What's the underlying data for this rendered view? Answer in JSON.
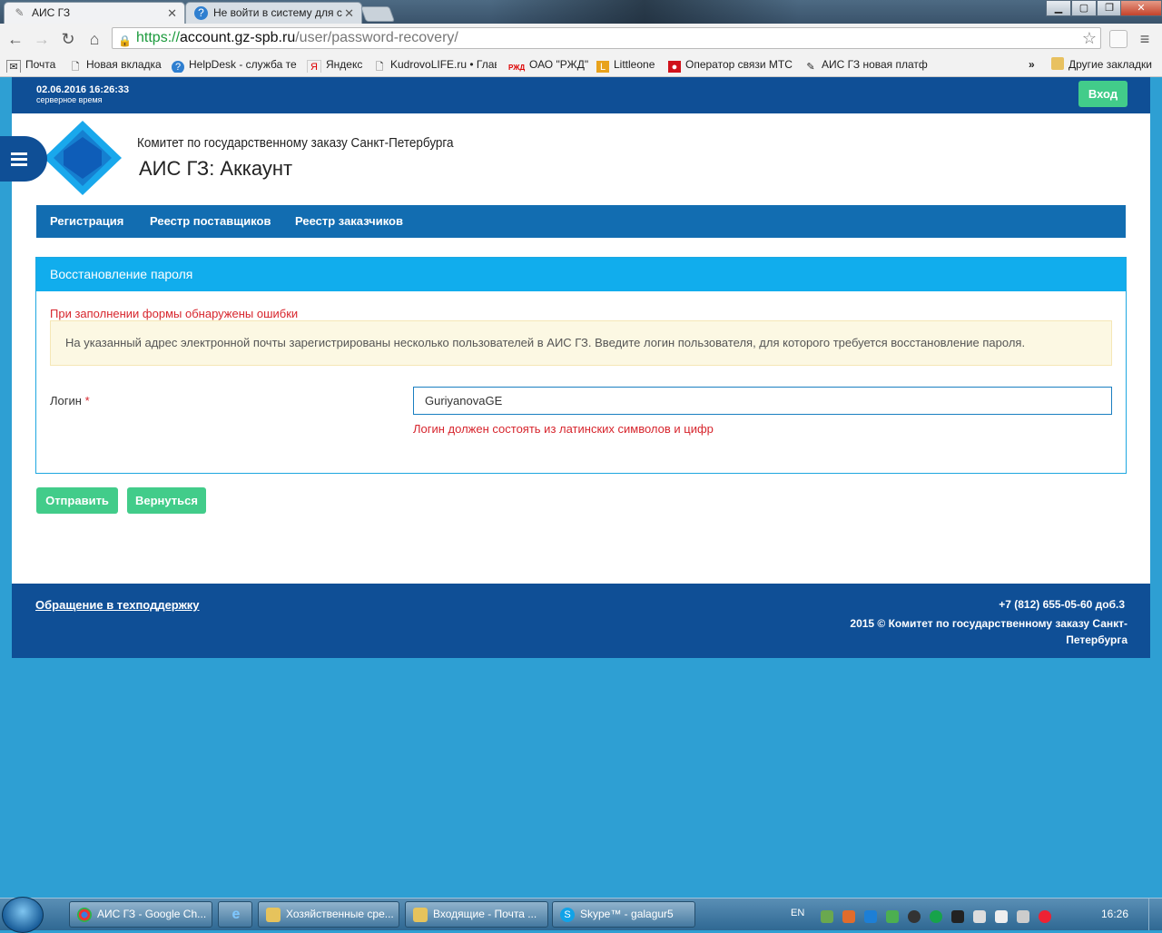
{
  "browser": {
    "tabs": [
      {
        "title": "АИС ГЗ",
        "active": true
      },
      {
        "title": "Не войти в систему для с",
        "active": false
      }
    ],
    "url": {
      "protocol": "https://",
      "host": "account.gz-spb.ru",
      "path": "/user/password-recovery/"
    },
    "bookmarks": [
      "Почта",
      "Новая вкладка",
      "HelpDesk - служба те",
      "Яндекс",
      "KudrovoLIFE.ru • Глав",
      "ОАО \"РЖД\"",
      "Littleone",
      "Оператор связи МТС",
      "АИС ГЗ новая платф"
    ],
    "bookmarks_overflow": "»",
    "other_bookmarks": "Другие закладки"
  },
  "header": {
    "server_time": "02.06.2016 16:26:33",
    "server_time_label": "серверное время",
    "login_button": "Вход",
    "org_name": "Комитет по государственному заказу Санкт-Петербурга",
    "app_title": "АИС ГЗ: Аккаунт"
  },
  "nav": {
    "items": [
      "Регистрация",
      "Реестр поставщиков",
      "Реестр заказчиков"
    ]
  },
  "panel": {
    "title": "Восстановление пароля",
    "error_summary": "При заполнении формы обнаружены ошибки",
    "alert": "На указанный адрес электронной почты зарегистрированы несколько пользователей в АИС ГЗ. Введите логин пользователя, для которого требуется восстановление пароля.",
    "login_label": "Логин",
    "required_mark": "*",
    "login_value": "GuriyanovaGE",
    "login_error": "Логин должен состоять из латинских символов и цифр"
  },
  "actions": {
    "submit": "Отправить",
    "back": "Вернуться"
  },
  "footer": {
    "support_link": "Обращение в техподдержку",
    "phone": "+7 (812) 655-05-60 доб.3",
    "copyright": "2015 © Комитет по государственному заказу Санкт-Петербурга"
  },
  "taskbar": {
    "tasks": [
      "АИС ГЗ - Google Ch...",
      "Хозяйственные сре...",
      "Входящие - Почта ...",
      "Skype™ - galagur5"
    ],
    "language": "EN",
    "clock": "16:26"
  },
  "colors": {
    "brand_dark": "#0f4f96",
    "nav": "#126db1",
    "panel_head": "#11aded",
    "accent_green": "#42cc8a",
    "error": "#d7252d",
    "background": "#2e9fd3"
  }
}
